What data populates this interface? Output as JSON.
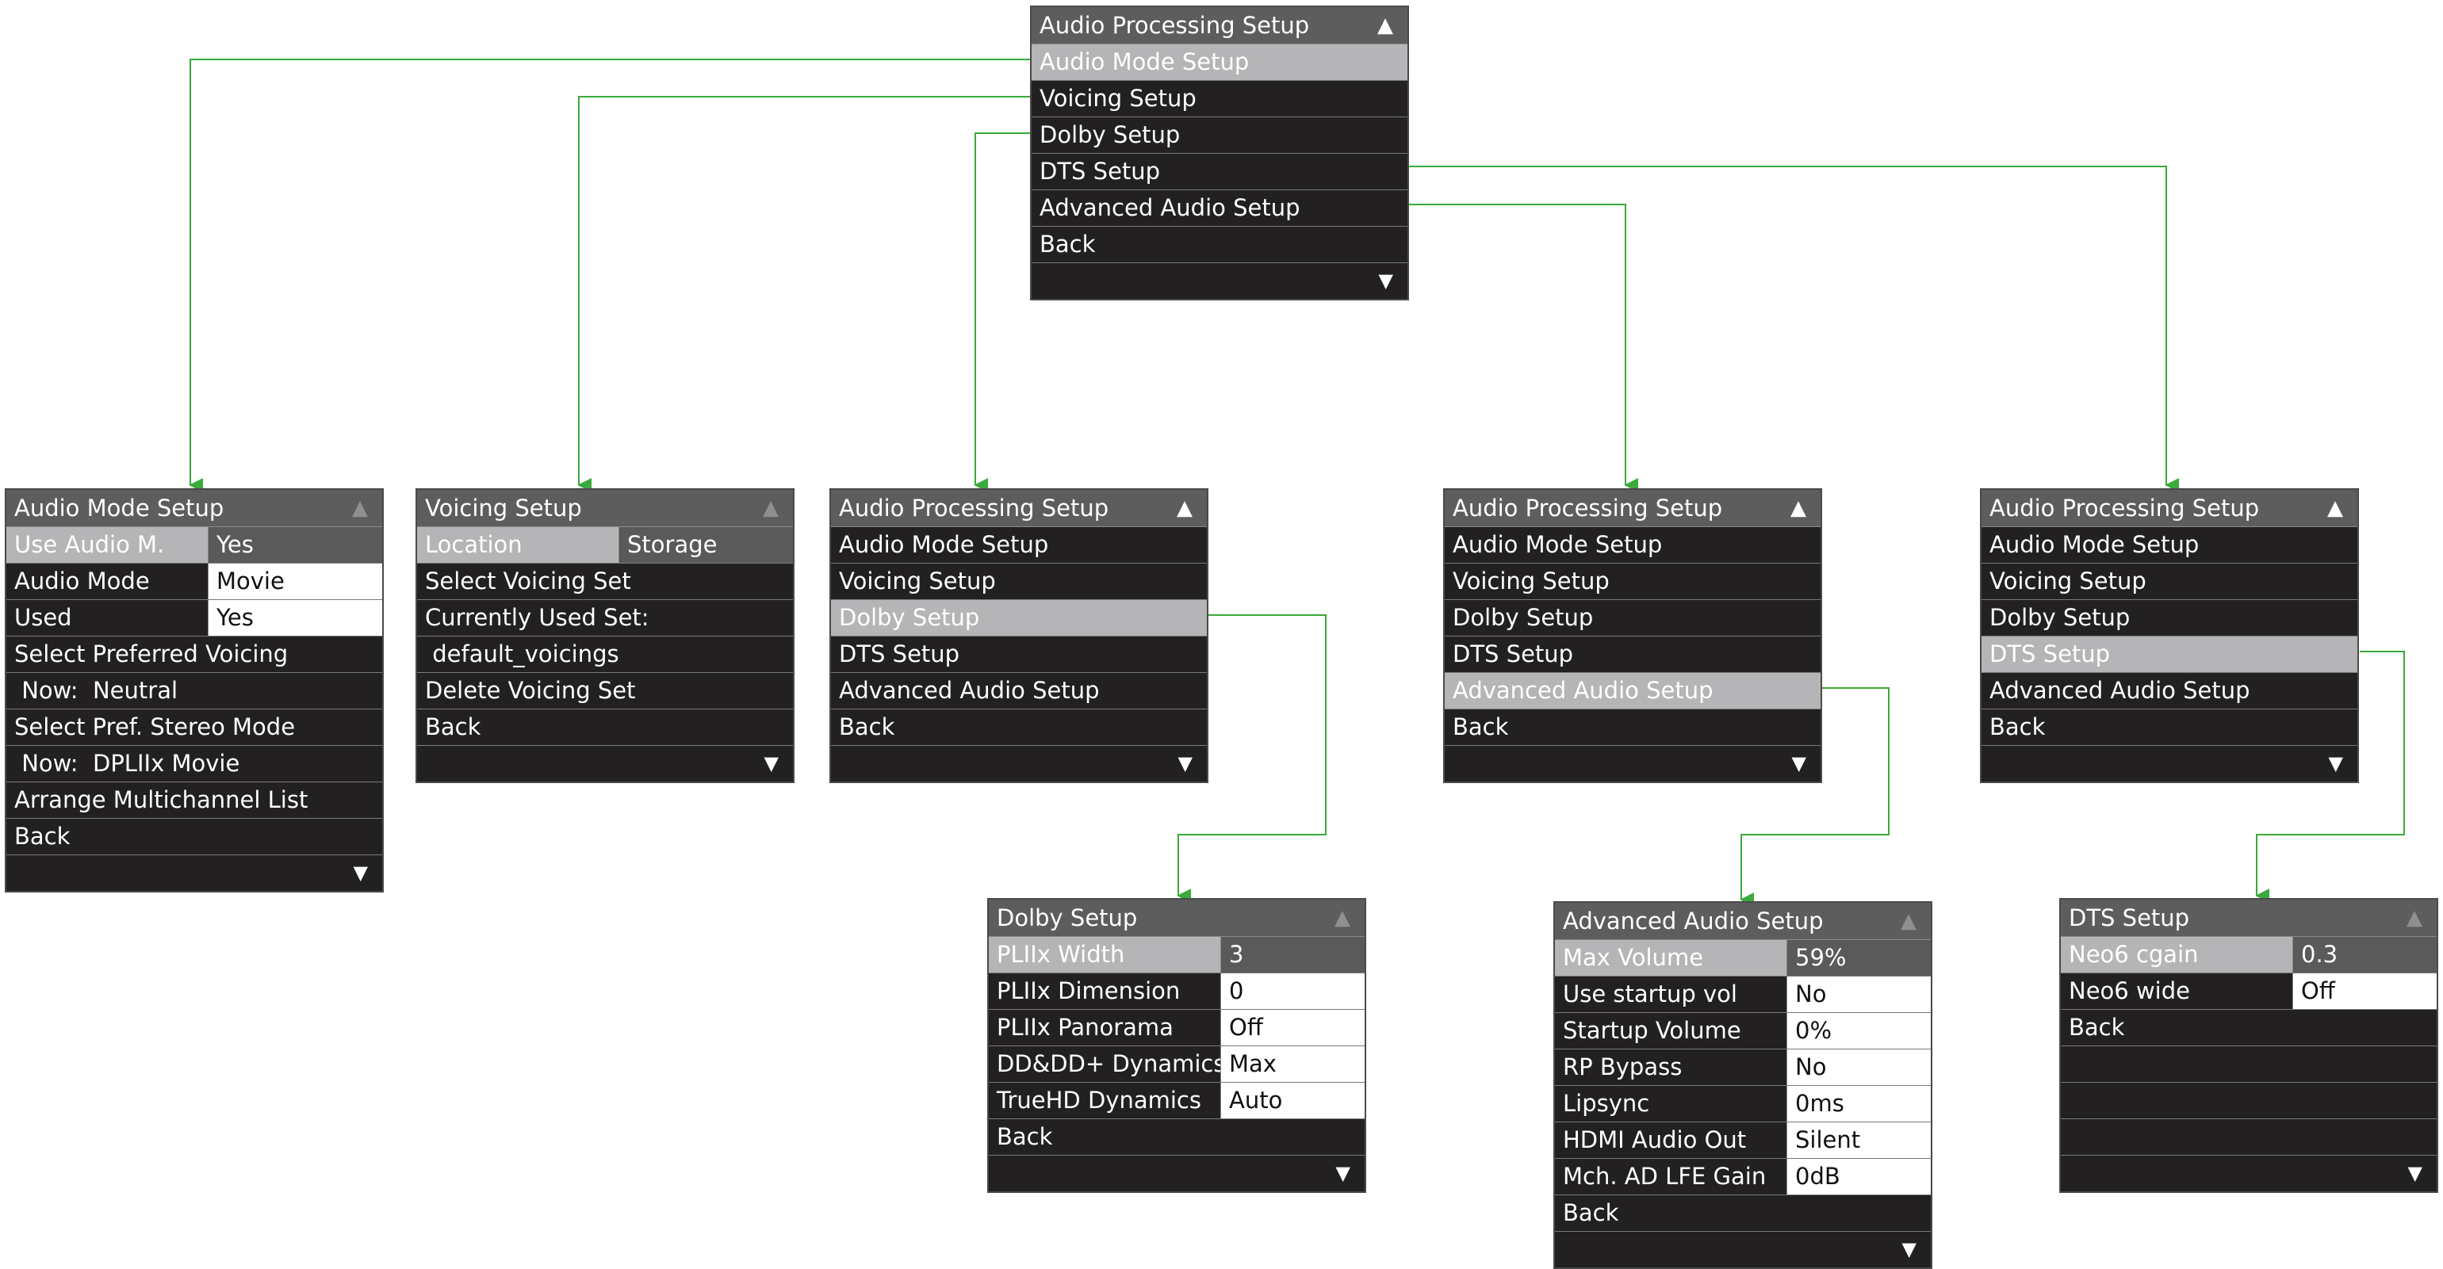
{
  "main_menu": {
    "title": "Audio Processing Setup",
    "items": [
      "Audio Mode Setup",
      "Voicing Setup",
      "Dolby Setup",
      "DTS Setup",
      "Advanced Audio Setup",
      "Back"
    ],
    "selected_index": 0
  },
  "audio_mode_menu": {
    "title": "Audio Mode Setup",
    "rows": [
      {
        "label": "Use Audio M.",
        "value": "Yes"
      },
      {
        "label": "Audio Mode",
        "value": "Movie"
      },
      {
        "label": "Used",
        "value": "Yes"
      },
      {
        "label": "Select Preferred Voicing"
      },
      {
        "label": " Now:  Neutral"
      },
      {
        "label": "Select Pref. Stereo Mode"
      },
      {
        "label": " Now:  DPLIIx Movie"
      },
      {
        "label": "Arrange Multichannel List"
      },
      {
        "label": "Back"
      }
    ]
  },
  "voicing_menu": {
    "title": "Voicing Setup",
    "rows": [
      {
        "label": "Location",
        "value": "Storage"
      },
      {
        "label": "Select Voicing Set"
      },
      {
        "label": "Currently Used Set:"
      },
      {
        "label": " default_voicings"
      },
      {
        "label": "Delete Voicing Set"
      },
      {
        "label": "Back"
      }
    ]
  },
  "proc_dolby_menu": {
    "title": "Audio Processing Setup",
    "items": [
      "Audio Mode Setup",
      "Voicing Setup",
      "Dolby Setup",
      "DTS Setup",
      "Advanced Audio Setup",
      "Back"
    ],
    "selected_index": 2
  },
  "proc_advanced_menu": {
    "title": "Audio Processing Setup",
    "items": [
      "Audio Mode Setup",
      "Voicing Setup",
      "Dolby Setup",
      "DTS Setup",
      "Advanced Audio Setup",
      "Back"
    ],
    "selected_index": 4
  },
  "proc_dts_menu": {
    "title": "Audio Processing Setup",
    "items": [
      "Audio Mode Setup",
      "Voicing Setup",
      "Dolby Setup",
      "DTS Setup",
      "Advanced Audio Setup",
      "Back"
    ],
    "selected_index": 3
  },
  "dolby_menu": {
    "title": "Dolby Setup",
    "rows": [
      {
        "label": "PLIIx Width",
        "value": "3"
      },
      {
        "label": "PLIIx Dimension",
        "value": "0"
      },
      {
        "label": "PLIIx Panorama",
        "value": "Off"
      },
      {
        "label": "DD&DD+ Dynamics",
        "value": "Max"
      },
      {
        "label": "TrueHD Dynamics",
        "value": "Auto"
      },
      {
        "label": "Back"
      }
    ]
  },
  "advanced_menu": {
    "title": "Advanced Audio Setup",
    "rows": [
      {
        "label": "Max Volume",
        "value": "59%"
      },
      {
        "label": "Use startup vol",
        "value": "No"
      },
      {
        "label": "Startup Volume",
        "value": "0%"
      },
      {
        "label": "RP Bypass",
        "value": "No"
      },
      {
        "label": "Lipsync",
        "value": "0ms"
      },
      {
        "label": "HDMI Audio Out",
        "value": "Silent"
      },
      {
        "label": "Mch. AD LFE Gain",
        "value": "0dB"
      },
      {
        "label": "Back"
      }
    ]
  },
  "dts_menu": {
    "title": "DTS Setup",
    "rows": [
      {
        "label": "Neo6 cgain",
        "value": "0.3"
      },
      {
        "label": "Neo6 wide",
        "value": "Off"
      },
      {
        "label": "Back"
      }
    ]
  },
  "colors": {
    "connector": "#3aaa3a",
    "menu_bg": "#232021",
    "title_bg": "#5d5d5d",
    "highlight": "#b5b5b7"
  },
  "icons": {
    "up": "chevron-up-icon",
    "down": "chevron-down-icon"
  }
}
